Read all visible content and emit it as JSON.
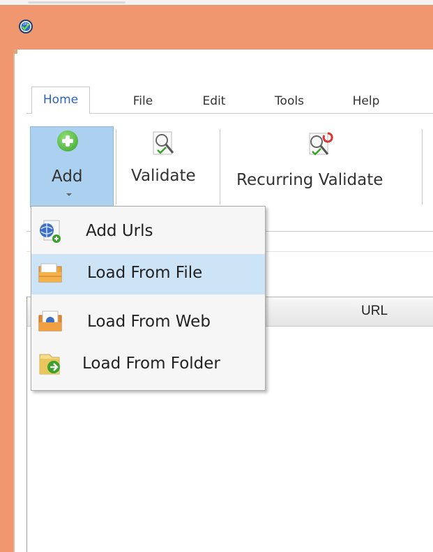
{
  "window": {
    "icon": "url-validator-app-icon",
    "colors": {
      "titlebar": "#f0976f",
      "selected_button": "#acd0ef",
      "menu_highlight": "#cde4f7",
      "active_tab_text": "#2d63b6"
    }
  },
  "tabs": [
    {
      "label": "Home",
      "active": true
    },
    {
      "label": "File"
    },
    {
      "label": "Edit"
    },
    {
      "label": "Tools"
    },
    {
      "label": "Help"
    }
  ],
  "ribbon": {
    "add": {
      "label": "Add",
      "icon": "plus-circle-icon"
    },
    "validate": {
      "label": "Validate",
      "icon": "magnifier-check-icon"
    },
    "recurring_validate": {
      "label": "Recurring Validate",
      "icon": "magnifier-refresh-icon"
    }
  },
  "add_menu": {
    "items": [
      {
        "label": "Add Urls",
        "icon": "globe-add-icon"
      },
      {
        "label": "Load From File",
        "icon": "folder-file-icon",
        "selected": true
      },
      {
        "label": "Load From Web",
        "icon": "folder-web-icon"
      },
      {
        "label": "Load From Folder",
        "icon": "folder-arrow-icon"
      }
    ]
  },
  "grid": {
    "columns": [
      "URL"
    ]
  }
}
